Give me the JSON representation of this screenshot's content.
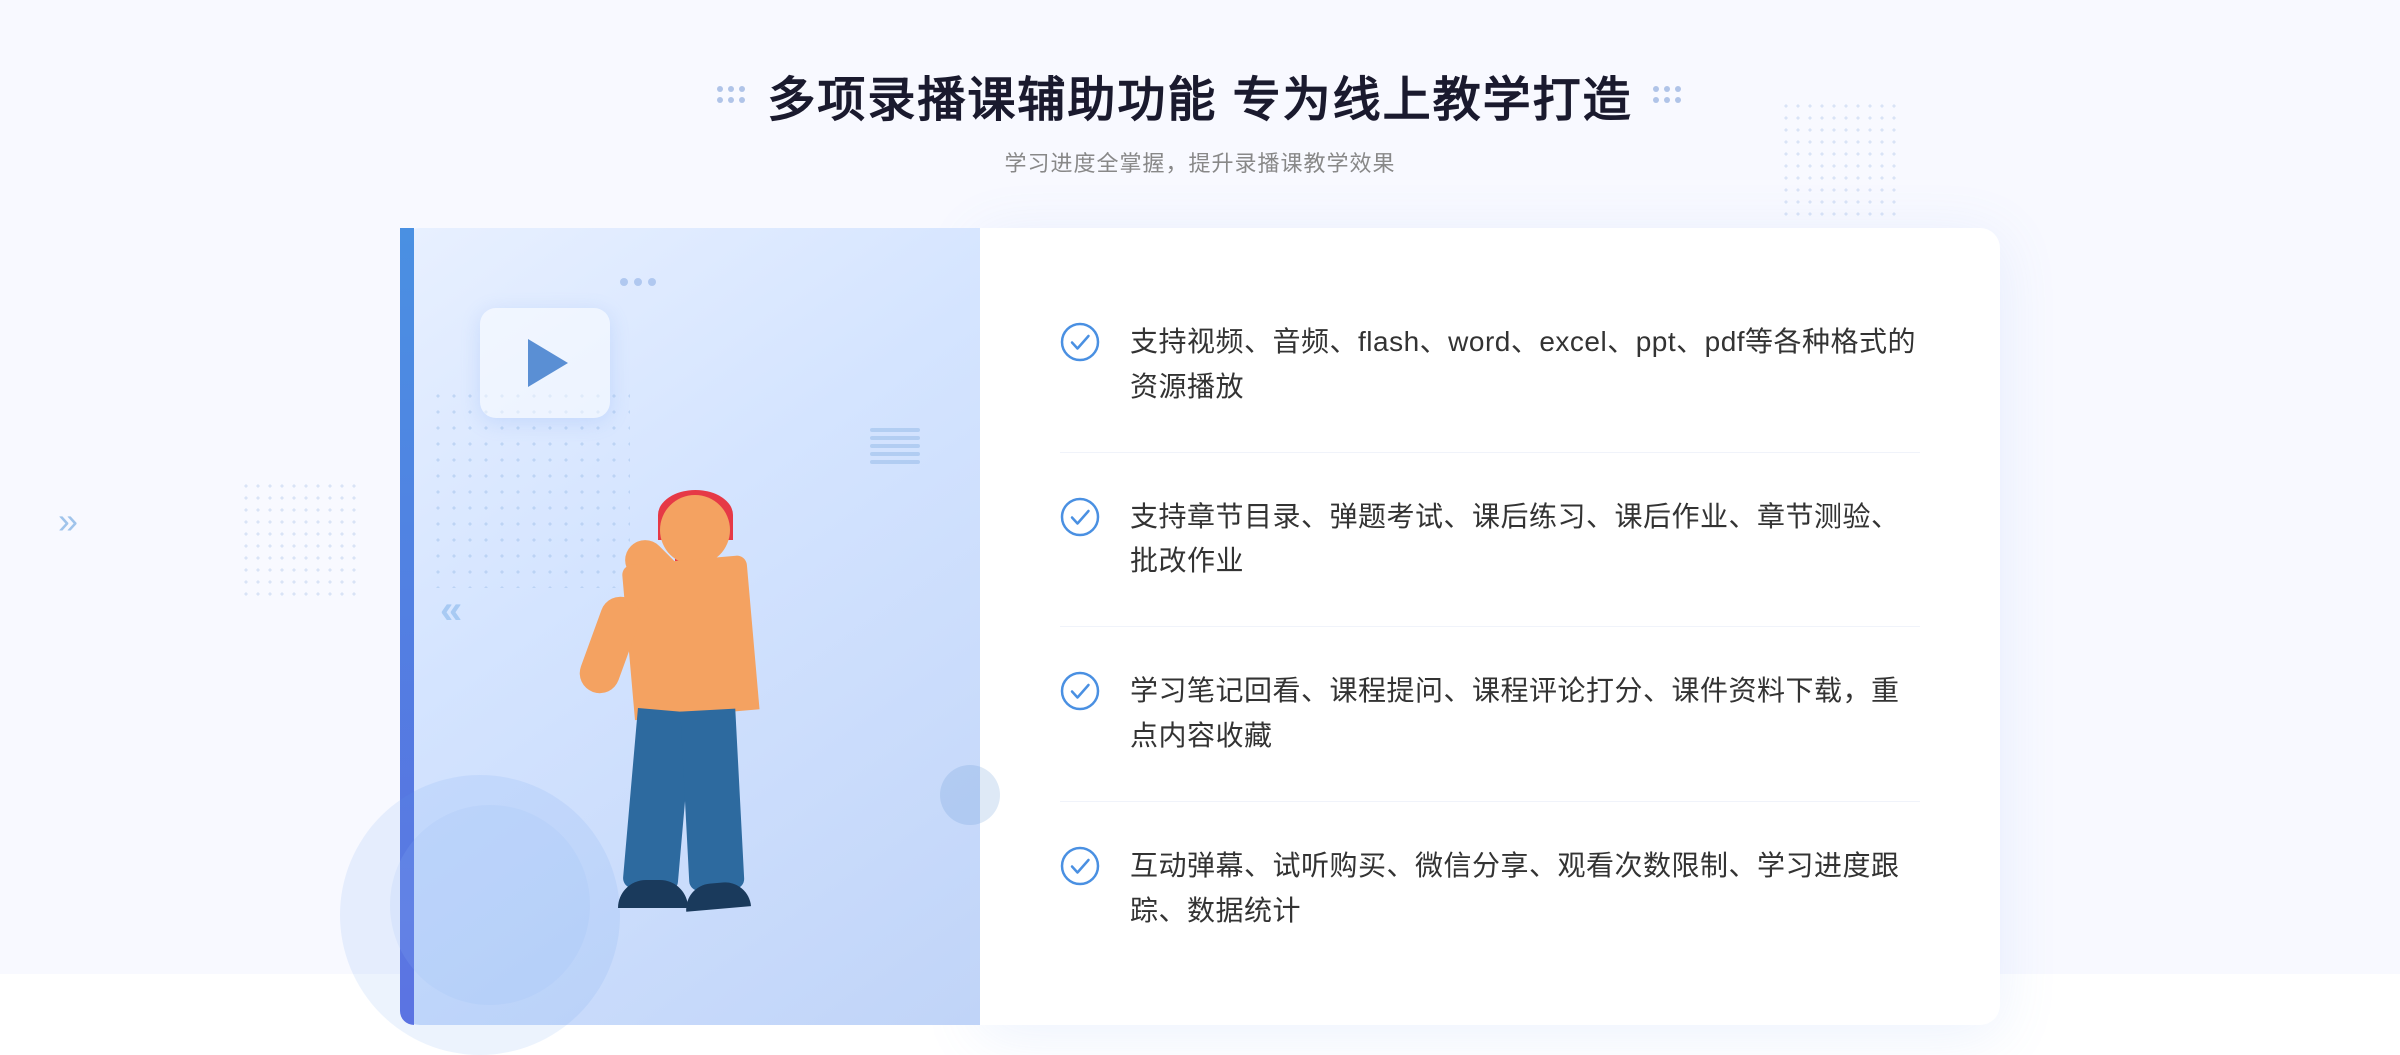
{
  "page": {
    "background": "#f8f9ff"
  },
  "header": {
    "title": "多项录播课辅助功能 专为线上教学打造",
    "subtitle": "学习进度全掌握，提升录播课教学效果"
  },
  "features": [
    {
      "id": 1,
      "text": "支持视频、音频、flash、word、excel、ppt、pdf等各种格式的资源播放"
    },
    {
      "id": 2,
      "text": "支持章节目录、弹题考试、课后练习、课后作业、章节测验、批改作业"
    },
    {
      "id": 3,
      "text": "学习笔记回看、课程提问、课程评论打分、课件资料下载，重点内容收藏"
    },
    {
      "id": 4,
      "text": "互动弹幕、试听购买、微信分享、观看次数限制、学习进度跟踪、数据统计"
    }
  ],
  "illustration": {
    "play_button_alt": "播放按钮",
    "figure_alt": "教师指向上方的插图"
  }
}
